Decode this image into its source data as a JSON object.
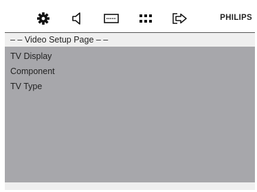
{
  "toolbar": {
    "icons": [
      "gear-icon",
      "speaker-icon",
      "subtitle-icon",
      "dots-grid-icon",
      "exit-arrow-icon"
    ],
    "brand": "PHILIPS"
  },
  "page": {
    "title": "– –  Video Setup Page  – –"
  },
  "menu": {
    "items": [
      {
        "label": "TV Display"
      },
      {
        "label": "Component"
      },
      {
        "label": "TV Type"
      }
    ]
  }
}
